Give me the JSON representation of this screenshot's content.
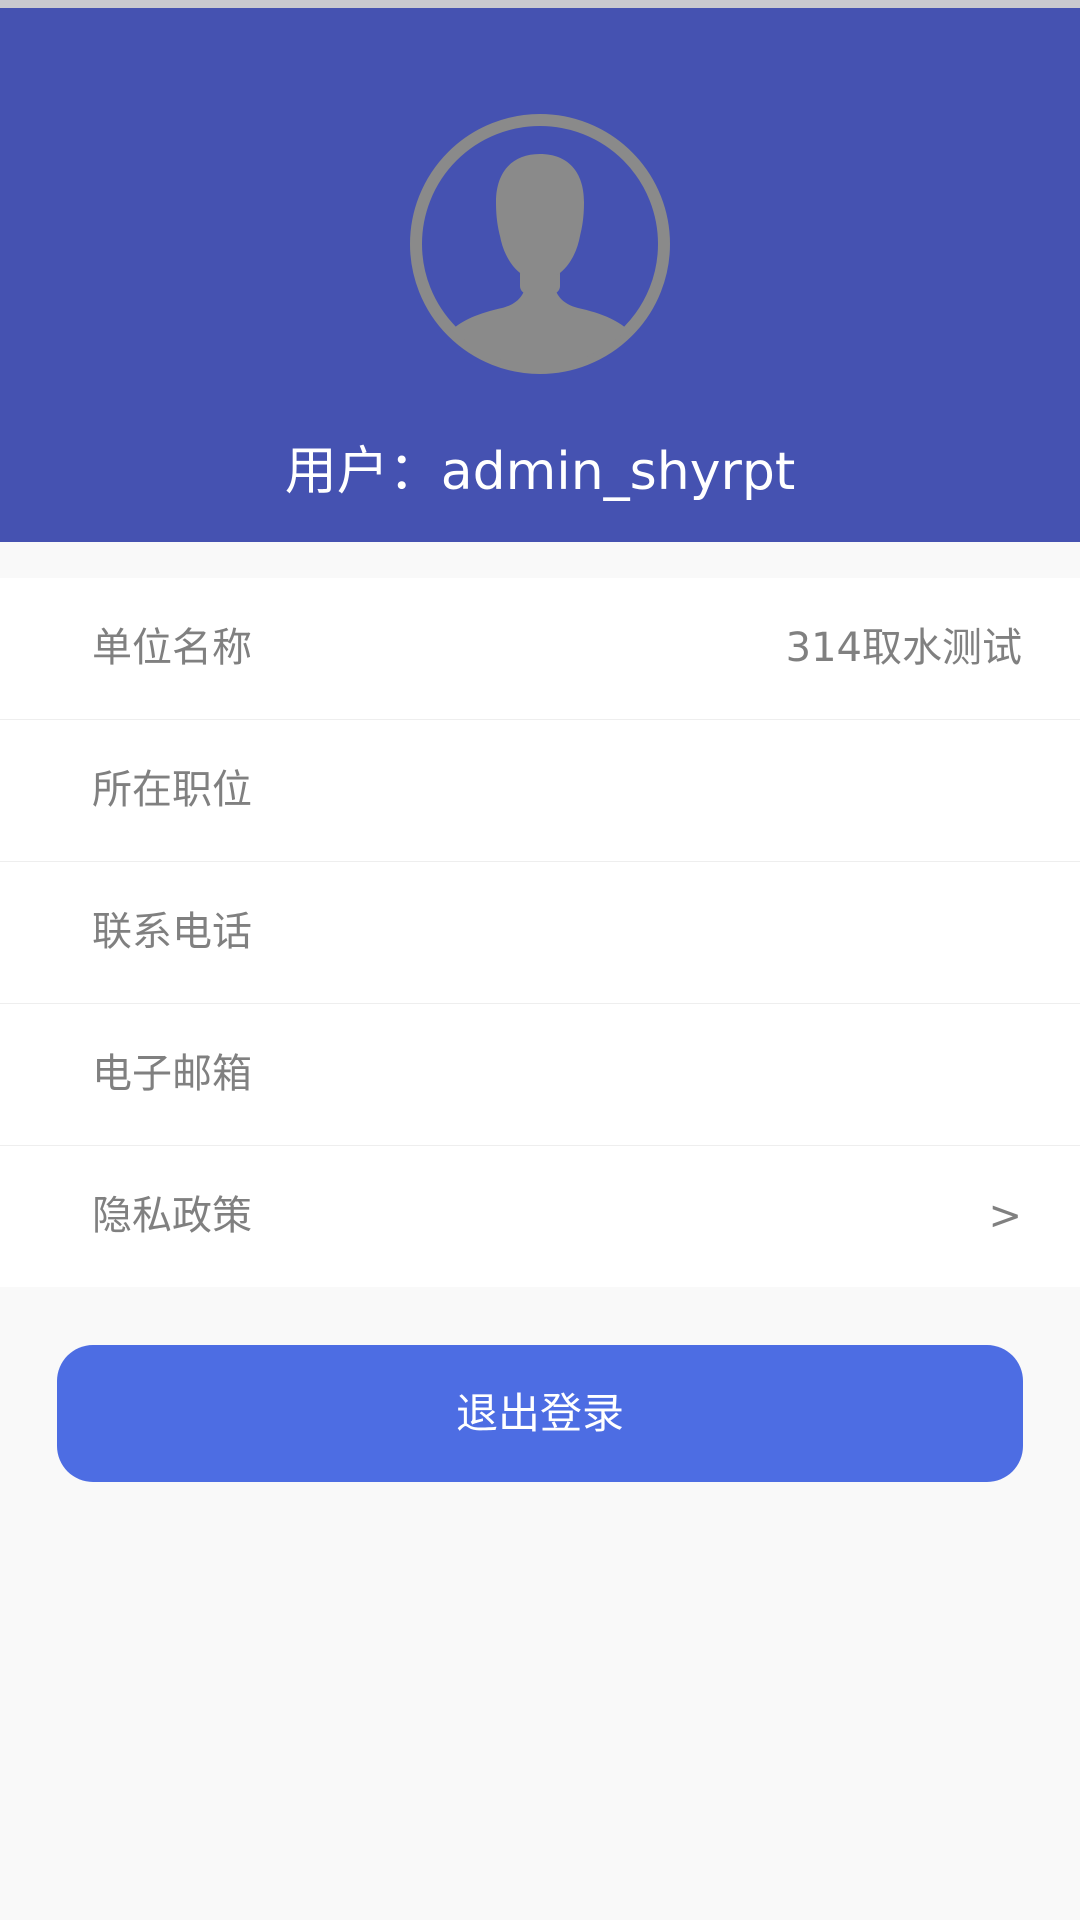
{
  "colors": {
    "header_bg": "#4552b1",
    "button_bg": "#4d6de3",
    "page_bg": "#f9f9f9",
    "avatar_gray": "#8a8a8a"
  },
  "header": {
    "avatar_icon": "user-avatar-icon",
    "username": "用户：admin_shyrpt"
  },
  "info_list": [
    {
      "label": "单位名称",
      "value": "314取水测试"
    },
    {
      "label": "所在职位",
      "value": ""
    },
    {
      "label": "联系电话",
      "value": ""
    },
    {
      "label": "电子邮箱",
      "value": ""
    },
    {
      "label": "隐私政策",
      "arrow": ">"
    }
  ],
  "logout": {
    "label": "退出登录"
  }
}
